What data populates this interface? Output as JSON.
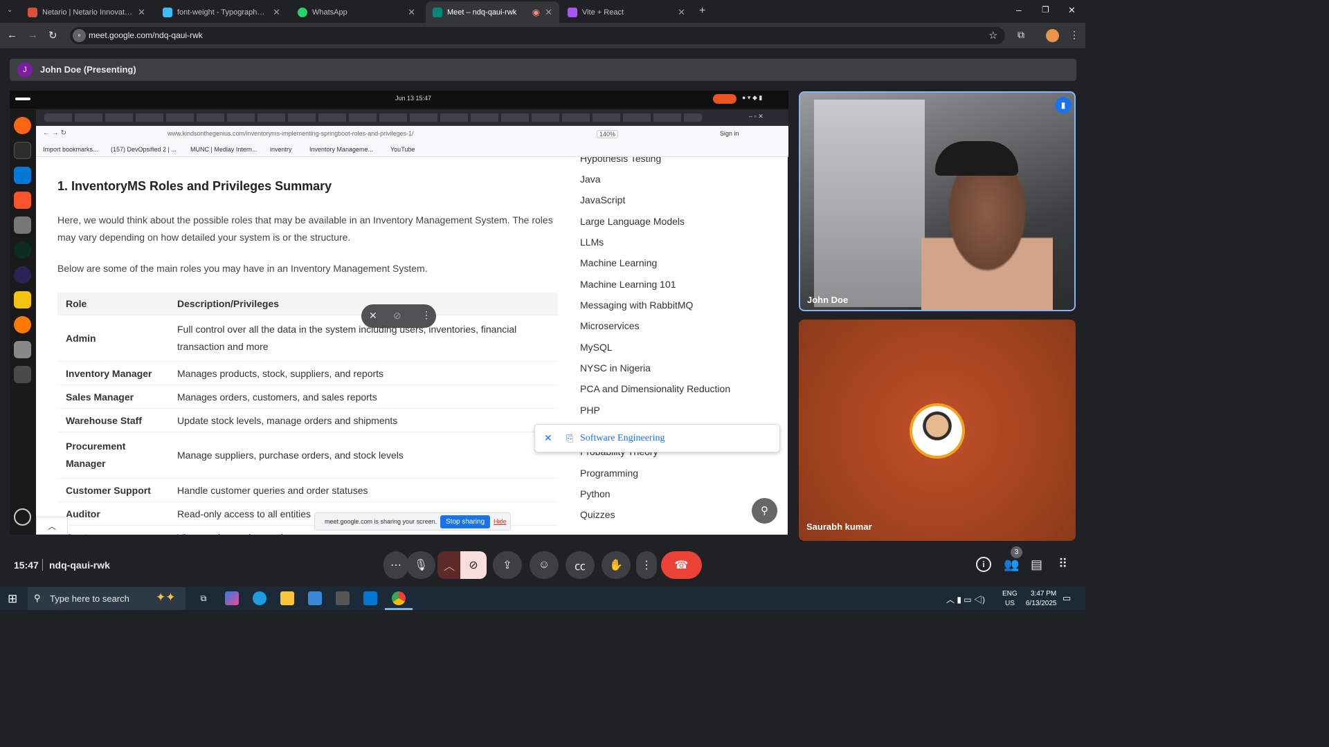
{
  "browser": {
    "tabs": [
      {
        "label": "Netario | Netario Innovations P...",
        "color": "#d8503a"
      },
      {
        "label": "font-weight - Typography - Tail...",
        "color": "#38bdf8"
      },
      {
        "label": "WhatsApp",
        "color": "#25d366"
      },
      {
        "label": "Meet – ndq-qaui-rwk",
        "color": "#00897b",
        "active": true
      },
      {
        "label": "Vite + React",
        "color": "#a855f7"
      }
    ],
    "url": "meet.google.com/ndq-qaui-rwk"
  },
  "meet": {
    "presenting_label": "John Doe (Presenting)",
    "presenter_initial": "J",
    "clock": "15:47",
    "meeting_code": "ndq-qaui-rwk",
    "participants_count": "3",
    "tiles": [
      {
        "name": "John Doe"
      },
      {
        "name": "Saurabh kumar"
      }
    ],
    "end_call_color": "#ea4335"
  },
  "shared": {
    "linux_clock": "Jun 13  15:47",
    "inner_url": "www.kindsonthegenius.com/inventoryms-implementing-springboot-roles-and-privileges-1/",
    "zoom": "140%",
    "sign_in": "Sign in",
    "bookmarks": [
      "Import bookmarks...",
      "(157) DevOpsified 2 | ...",
      "MUNC | Medlay Intern...",
      "inventry",
      "Inventory Manageme...",
      "YouTube"
    ],
    "heading": "1. InventoryMS Roles and Privileges Summary",
    "para1": "Here, we would think about the possible roles that may be available in an Inventory Management System. The roles may vary depending on how detailed your system is or the structure.",
    "para2": "Below are some of the main roles you may have in an Inventory Management System.",
    "table_headers": [
      "Role",
      "Description/Privileges"
    ],
    "rows": [
      {
        "role": "Admin",
        "desc": "Full control over all the data in the system including users, inventories, financial transaction and more"
      },
      {
        "role": "Inventory Manager",
        "desc": "Manages products, stock, suppliers, and reports"
      },
      {
        "role": "Sales Manager",
        "desc": "Manages orders, customers, and sales reports"
      },
      {
        "role": "Warehouse Staff",
        "desc": "Update stock levels, manage orders and shipments"
      },
      {
        "role": "Procurement Manager",
        "desc": "Manage suppliers, purchase orders, and stock levels"
      },
      {
        "role": "Customer Support",
        "desc": "Handle customer queries and order statuses"
      },
      {
        "role": "Auditor",
        "desc": "Read-only access to all entities"
      },
      {
        "role": "Customer",
        "desc": "View products, place orders, trac..."
      }
    ],
    "sidebar": [
      "Hypothesis Testing",
      "Java",
      "JavaScript",
      "Large Language Models",
      "LLMs",
      "Machine Learning",
      "Machine Learning 101",
      "Messaging with RabbitMQ",
      "Microservices",
      "MySQL",
      "NYSC in Nigeria",
      "PCA and Dimensionality Reduction",
      "PHP",
      "Probability Theory",
      "Programming",
      "Python",
      "Quizzes"
    ],
    "popup_item": "Software Engineering",
    "sharing_notice": "meet.google.com is sharing your screen.",
    "stop_sharing": "Stop sharing",
    "hide": "Hide"
  },
  "taskbar": {
    "search_placeholder": "Type here to search",
    "lang": "ENG",
    "region": "US",
    "time": "3:47 PM",
    "date": "6/13/2025"
  }
}
